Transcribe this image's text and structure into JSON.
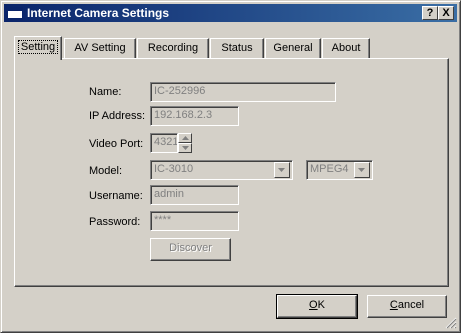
{
  "window": {
    "title": "Internet Camera Settings",
    "help_glyph": "?",
    "close_glyph": "X"
  },
  "tabs": [
    {
      "label": "Setting",
      "active": true
    },
    {
      "label": "AV Setting",
      "active": false
    },
    {
      "label": "Recording",
      "active": false
    },
    {
      "label": "Status",
      "active": false
    },
    {
      "label": "General",
      "active": false
    },
    {
      "label": "About",
      "active": false
    }
  ],
  "form": {
    "name_label": "Name:",
    "name_value": "IC-252996",
    "ip_label": "IP Address:",
    "ip_value": "192.168.2.3",
    "port_label": "Video Port:",
    "port_value": "4321",
    "model_label": "Model:",
    "model_value": "IC-3010",
    "codec_value": "MPEG4",
    "username_label": "Username:",
    "username_value": "admin",
    "password_label": "Password:",
    "password_value": "****",
    "discover_label": "Discover"
  },
  "footer": {
    "ok_mnemonic": "O",
    "ok_rest": "K",
    "cancel_mnemonic": "C",
    "cancel_rest": "ancel"
  },
  "colors": {
    "titlebar_start": "#0a246a",
    "titlebar_end": "#3a6ea5",
    "face": "#d4d0c8",
    "disabled_text": "#808080"
  },
  "icons": [
    "window-icon",
    "help-icon",
    "close-icon",
    "spin-up-icon",
    "spin-down-icon",
    "dropdown-arrow-icon",
    "size-grip-icon"
  ]
}
